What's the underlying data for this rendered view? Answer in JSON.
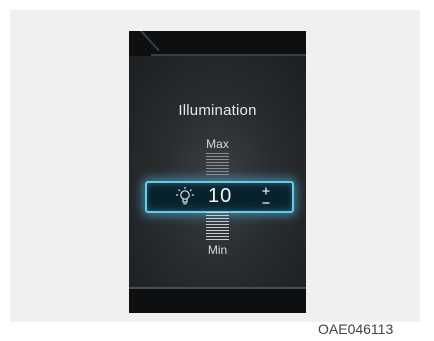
{
  "screen": {
    "title": "Illumination",
    "max_label": "Max",
    "min_label": "Min",
    "value": "10",
    "level_fraction": 0.5,
    "icons": {
      "left": "bulb-icon",
      "right": "plus-minus-icon"
    },
    "colors": {
      "highlight": "#67cbe6",
      "display_background": "#191b1d"
    }
  },
  "caption": "OAE046113"
}
